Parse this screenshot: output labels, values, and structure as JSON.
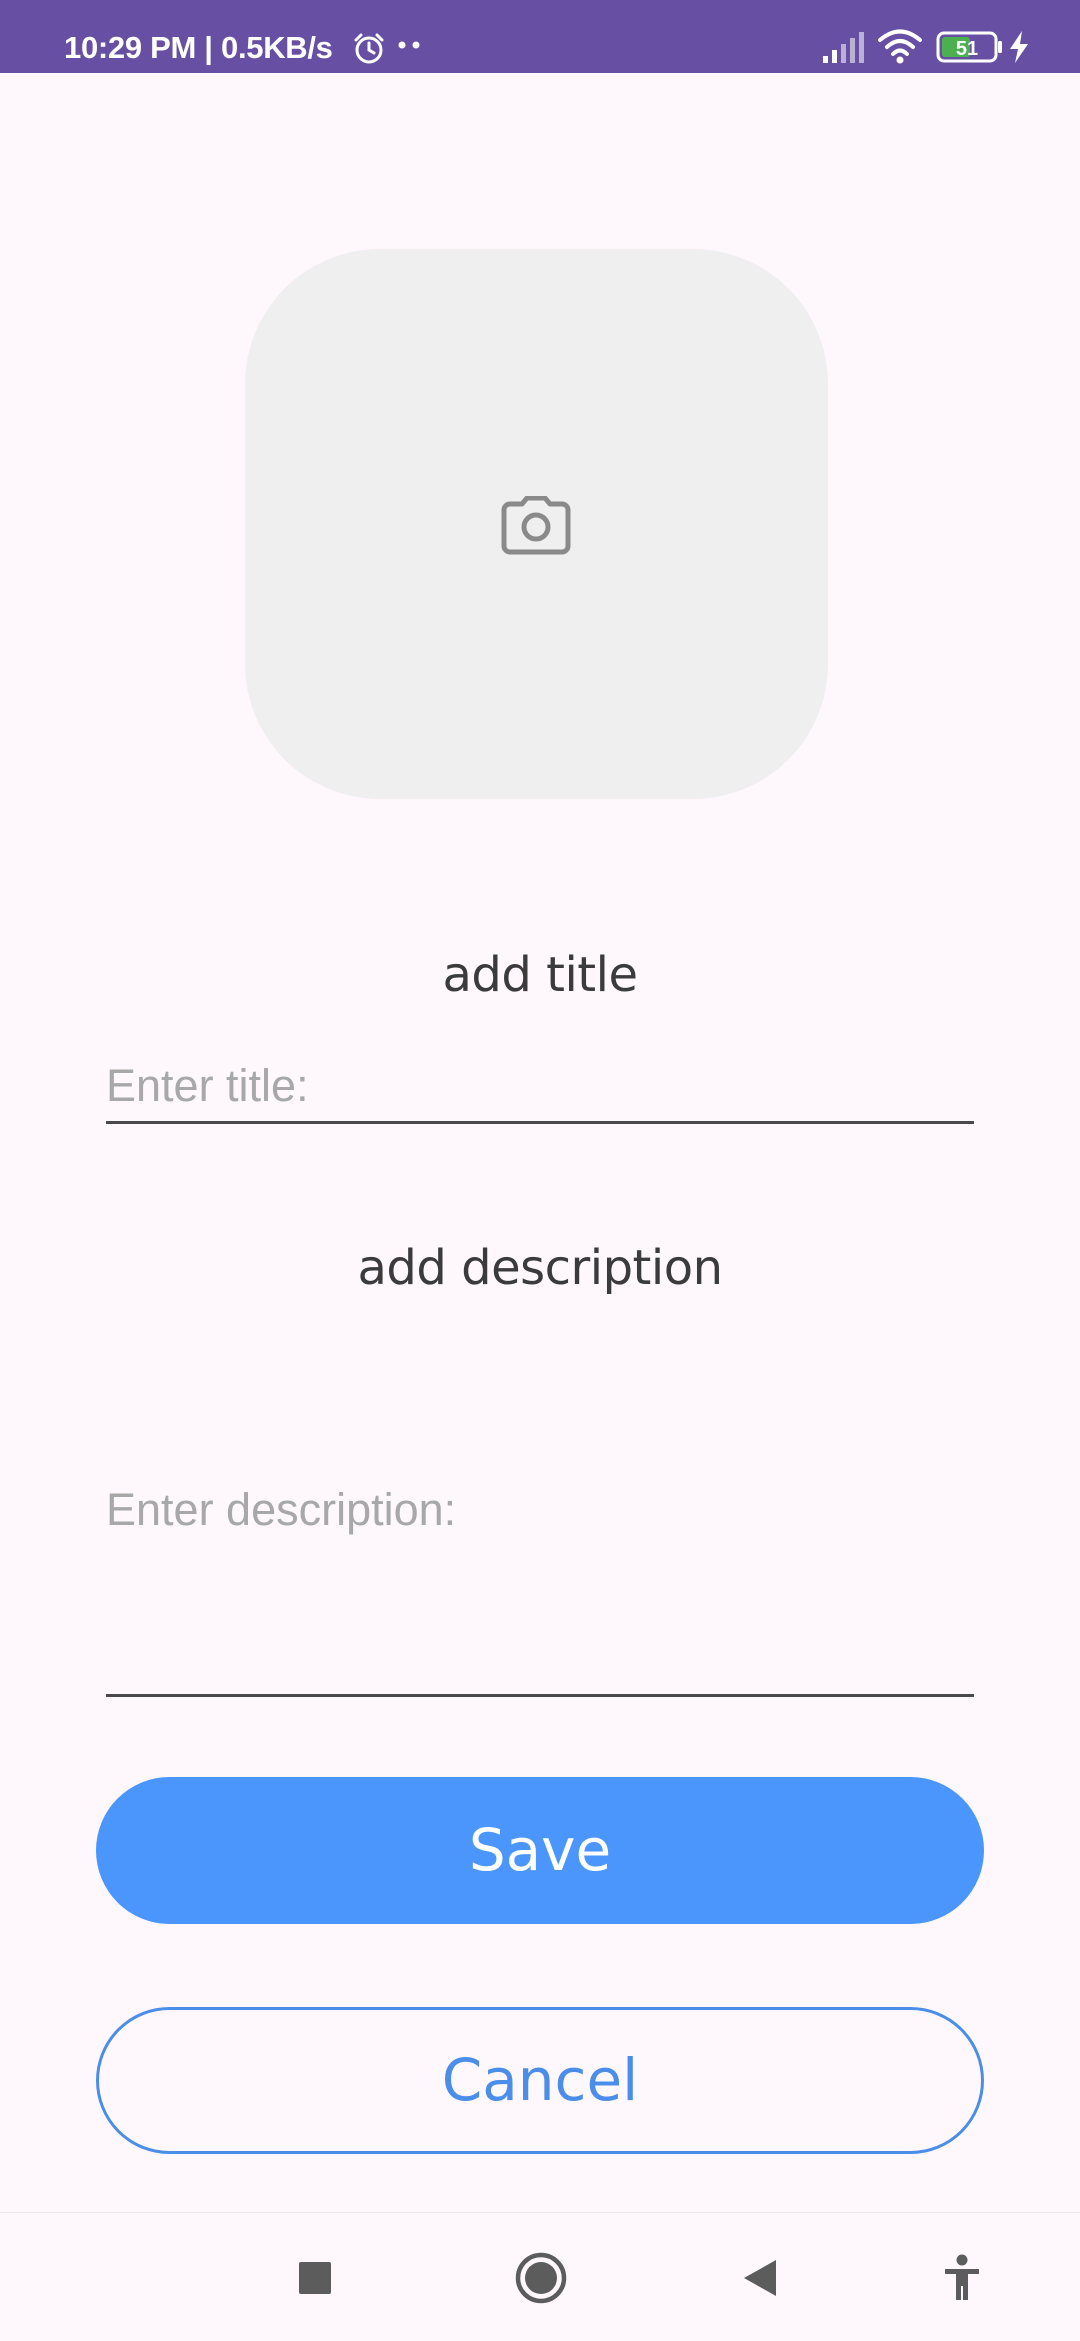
{
  "status_bar": {
    "text": "10:29 PM | 0.5KB/s",
    "battery": "51",
    "icons": [
      "alarm-icon",
      "more-dots-icon",
      "signal-icon",
      "wifi-icon",
      "battery-icon",
      "charging-icon"
    ]
  },
  "photo": {
    "icon": "camera-icon"
  },
  "title_section": {
    "label": "add title",
    "placeholder": "Enter title:",
    "value": ""
  },
  "description_section": {
    "label": "add description",
    "placeholder": "Enter description:",
    "value": ""
  },
  "buttons": {
    "save_label": "Save",
    "cancel_label": "Cancel"
  },
  "colors": {
    "status_bar": "#6750A4",
    "background": "#FEF8FD",
    "accent": "#4B96FC",
    "photo_bg": "#EFEFEF"
  },
  "nav_bar": {
    "icons": [
      "recents-square-icon",
      "home-circle-icon",
      "back-triangle-icon",
      "accessibility-icon"
    ]
  }
}
